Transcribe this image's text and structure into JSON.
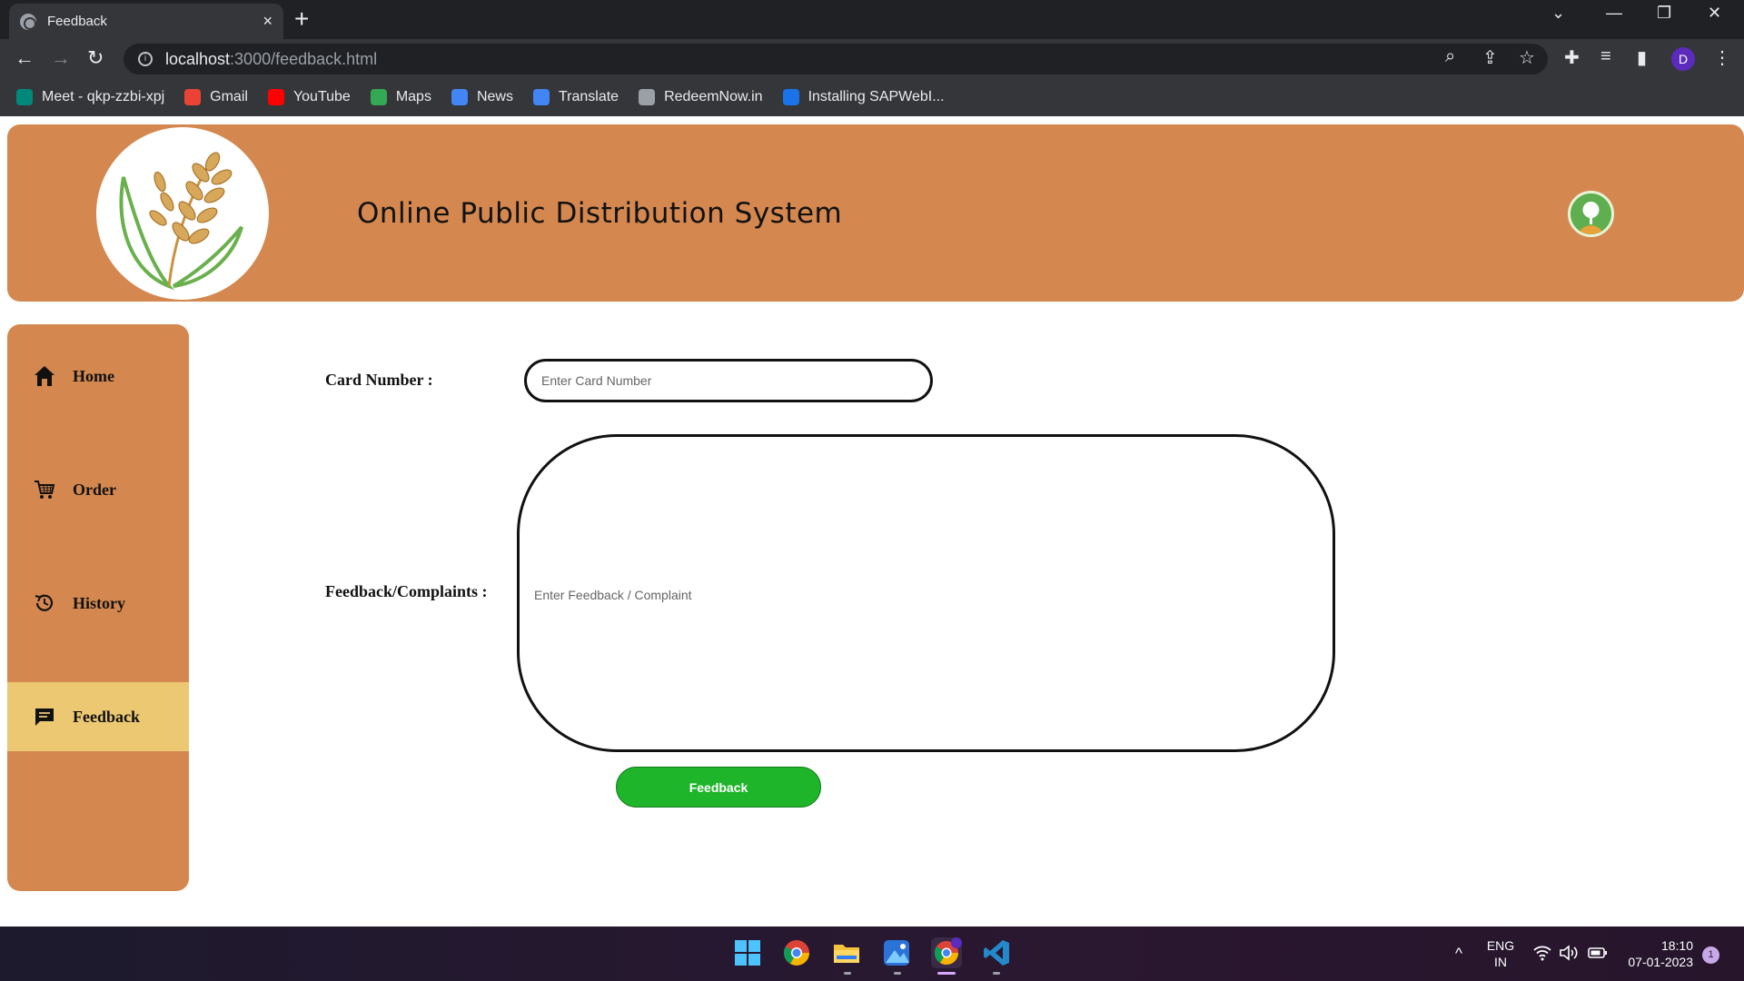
{
  "browser": {
    "tab_title": "Feedback",
    "tab_close": "×",
    "new_tab": "+",
    "url_host": "localhost",
    "url_path": ":3000/feedback.html",
    "bookmarks": [
      {
        "label": "Meet - qkp-zzbi-xpj",
        "color": "#00897b"
      },
      {
        "label": "Gmail",
        "color": "#ea4335"
      },
      {
        "label": "YouTube",
        "color": "#ff0000"
      },
      {
        "label": "Maps",
        "color": "#34a853"
      },
      {
        "label": "News",
        "color": "#4285f4"
      },
      {
        "label": "Translate",
        "color": "#4285f4"
      },
      {
        "label": "RedeemNow.in",
        "color": "#9aa0a6"
      },
      {
        "label": "Installing SAPWebI...",
        "color": "#1a73e8"
      }
    ],
    "profile_initial": "D"
  },
  "header": {
    "title": "Online Public Distribution System",
    "bg_color": "#d4884f"
  },
  "sidebar": {
    "items": [
      {
        "label": "Home",
        "icon": "home-icon"
      },
      {
        "label": "Order",
        "icon": "cart-icon"
      },
      {
        "label": "History",
        "icon": "history-icon"
      },
      {
        "label": "Feedback",
        "icon": "chat-icon",
        "active": true
      }
    ],
    "active_color": "#ecc872"
  },
  "form": {
    "card_label": "Card Number :",
    "card_placeholder": "Enter Card Number",
    "feedback_label": "Feedback/Complaints :",
    "feedback_placeholder": "Enter Feedback / Complaint",
    "submit_label": "Feedback",
    "submit_color": "#1fb52a"
  },
  "taskbar": {
    "lang_top": "ENG",
    "lang_bottom": "IN",
    "time": "18:10",
    "date": "07-01-2023",
    "notification_count": "1",
    "chevron": "^"
  }
}
